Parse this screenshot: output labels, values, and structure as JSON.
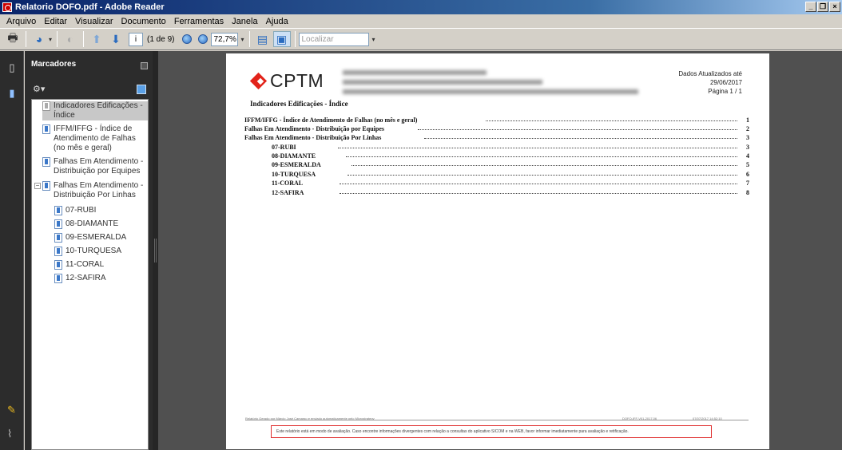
{
  "window": {
    "title": "Relatorio DOFO.pdf - Adobe Reader",
    "controls": [
      "_",
      "❐",
      "×"
    ]
  },
  "menu": [
    "Arquivo",
    "Editar",
    "Visualizar",
    "Documento",
    "Ferramentas",
    "Janela",
    "Ajuda"
  ],
  "toolbar": {
    "page_current": "i",
    "page_of": "(1 de 9)",
    "zoom": "72,7%",
    "search_placeholder": "Localizar"
  },
  "panel": {
    "title": "Marcadores",
    "bookmarks": [
      {
        "label": "Indicadores Edificações - Índice"
      },
      {
        "label": "IFFM/IFFG - Índice de Atendimento de Falhas (no mês e geral)"
      },
      {
        "label": "Falhas Em Atendimento - Distribuição por Equipes"
      },
      {
        "label": "Falhas Em Atendimento - Distribuição Por Linhas"
      },
      {
        "label": "07-RUBI"
      },
      {
        "label": "08-DIAMANTE"
      },
      {
        "label": "09-ESMERALDA"
      },
      {
        "label": "10-TURQUESA"
      },
      {
        "label": "11-CORAL"
      },
      {
        "label": "12-SAFIRA"
      }
    ]
  },
  "document": {
    "logo_text": "CPTM",
    "header_right": [
      "Dados Atualizados até",
      "29/06/2017",
      "Página 1 / 1"
    ],
    "title": "Indicadores Edificações - Índice",
    "toc": [
      {
        "label": "IFFM/IFFG -  Índice de Atendimento de Falhas (no mês e geral)",
        "page": "1"
      },
      {
        "label": "Falhas Em Atendimento - Distribuição por Equipes",
        "page": "2"
      },
      {
        "label": "Falhas Em Atendimento - Distribuição Por Linhas",
        "page": "3"
      },
      {
        "label": "07-RUBI",
        "page": "3"
      },
      {
        "label": "08-DIAMANTE",
        "page": "4"
      },
      {
        "label": "09-ESMERALDA",
        "page": "5"
      },
      {
        "label": "10-TURQUESA",
        "page": "6"
      },
      {
        "label": "11-CORAL",
        "page": "7"
      },
      {
        "label": "12-SAFIRA",
        "page": "8"
      }
    ],
    "footer_left": "Relatório Gerado por Márcio José Camargo e enviado automaticamente pelo Microstrategy",
    "footer_mid": "DOFO-IFF-V01-2017.06",
    "footer_right": "07/07/2017 14:52:10",
    "notice": "Este relatório está em modo de avaliação. Caso encontre informações divergentes com relação a consultas do aplicativo SICOM e na WEB, favor informar imediatamente para avaliação e retificação."
  }
}
